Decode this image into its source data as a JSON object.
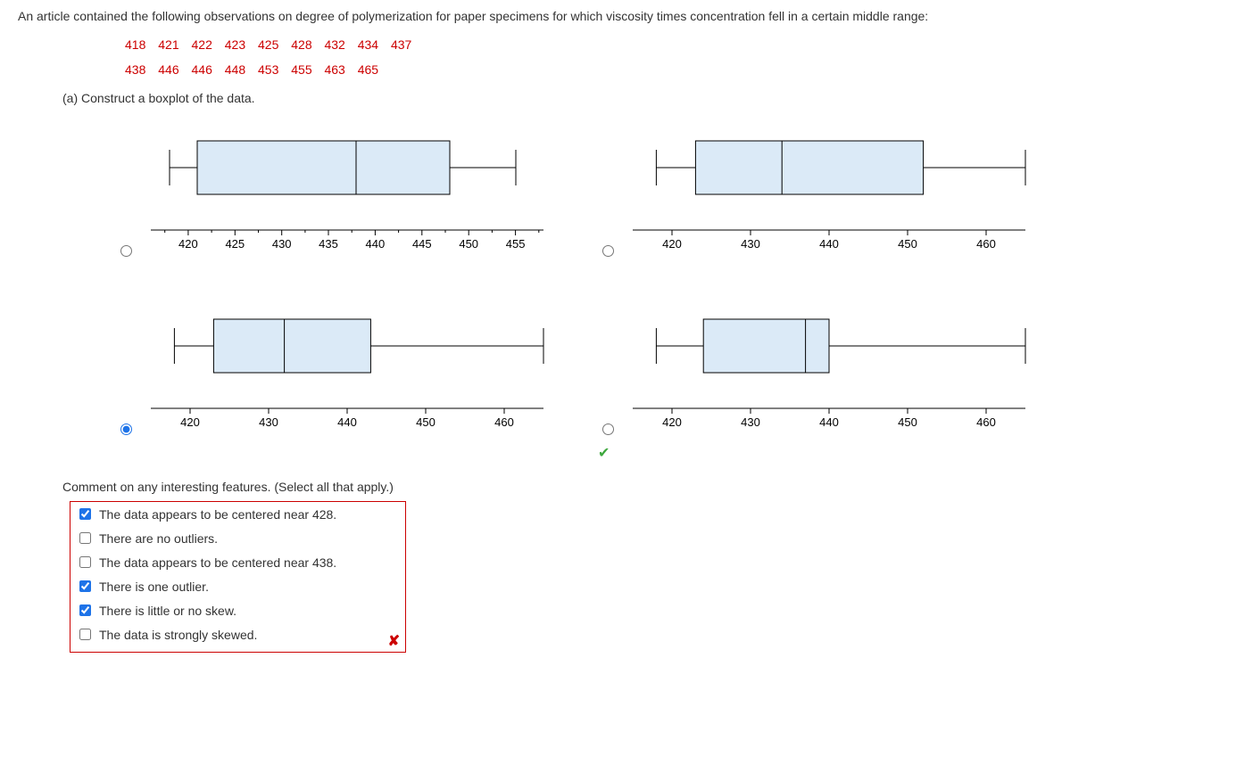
{
  "intro": "An article contained the following observations on degree of polymerization for paper specimens for which viscosity times concentration fell in a certain middle range:",
  "data_row1": "418  421  422  423  425  428  432  434  437",
  "data_row2": "438  446  446  448  453  455  463  465",
  "part_a": "(a) Construct a boxplot of the data.",
  "comment_prompt": "Comment on any interesting features. (Select all that apply.)",
  "checkboxes": {
    "c1": "The data appears to be centered near 428.",
    "c2": "There are no outliers.",
    "c3": "The data appears to be centered near 438.",
    "c4": "There is one outlier.",
    "c5": "There is little or no skew.",
    "c6": "The data is strongly skewed."
  },
  "chart_data": [
    {
      "type": "boxplot",
      "min": 418,
      "q1": 421,
      "median": 438,
      "q3": 448,
      "max": 455,
      "xticks": [
        420,
        425,
        430,
        435,
        440,
        445,
        450,
        455
      ]
    },
    {
      "type": "boxplot",
      "min": 418,
      "q1": 423,
      "median": 434,
      "q3": 452,
      "max": 465,
      "xticks": [
        420,
        430,
        440,
        450,
        460
      ]
    },
    {
      "type": "boxplot",
      "min": 418,
      "q1": 423,
      "median": 432,
      "q3": 443,
      "max": 465,
      "xticks": [
        420,
        430,
        440,
        450,
        460
      ]
    },
    {
      "type": "boxplot",
      "min": 418,
      "q1": 424,
      "median": 437,
      "q3": 440,
      "max": 465,
      "xticks": [
        420,
        430,
        440,
        450,
        460
      ]
    }
  ],
  "ticks": {
    "p1": {
      "t0": "420",
      "t1": "425",
      "t2": "430",
      "t3": "435",
      "t4": "440",
      "t5": "445",
      "t6": "450",
      "t7": "455"
    },
    "p2": {
      "t0": "420",
      "t1": "430",
      "t2": "440",
      "t3": "450",
      "t4": "460"
    },
    "p3": {
      "t0": "420",
      "t1": "430",
      "t2": "440",
      "t3": "450",
      "t4": "460"
    },
    "p4": {
      "t0": "420",
      "t1": "430",
      "t2": "440",
      "t3": "450",
      "t4": "460"
    }
  }
}
